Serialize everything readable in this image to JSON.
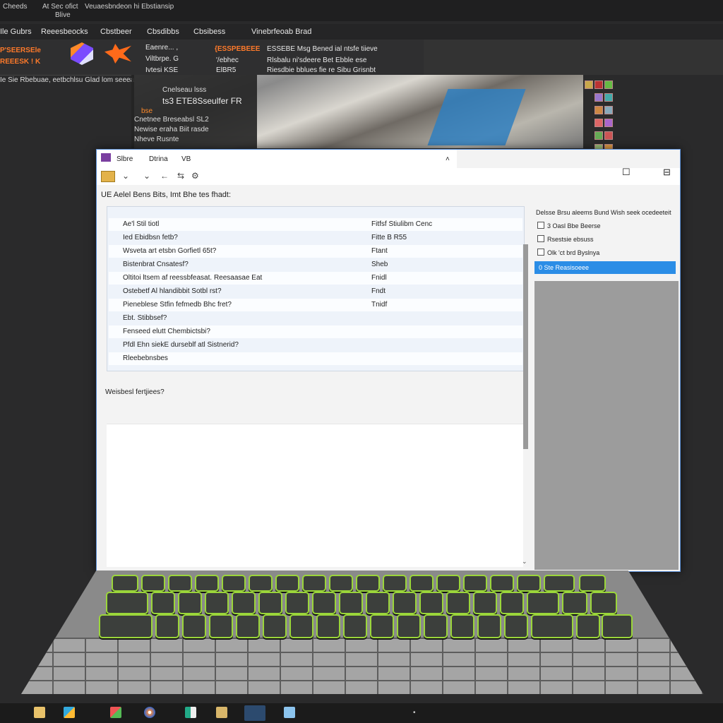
{
  "topmenu": {
    "items": [
      "Cheeds",
      "At Sec ofict",
      "Blive",
      "Veuaesbndeon hi Ebstiansip"
    ]
  },
  "menubar": {
    "items": [
      "Ile Gubrs",
      "Reeesbeocks",
      "Cbstbeer",
      "Cbsdibbs",
      "Cbsibess",
      "Vinebrfeoab Brad"
    ]
  },
  "toolbar": {
    "left_title": "P'SEERSEle",
    "left_sub": "REEESK ! K",
    "items": [
      "Eaenre... ,",
      "Viltbrpe. G",
      "Ivtesi KSE",
      "{ESSPEBEEE",
      "'/ebhec",
      "ElBR5",
      "ESSEBE Msg Bened ial ntsfe tiieve",
      "Rlsbalu ni'sdeere Bet Ebble ese",
      "Riesdbie bblues fie re Sibu Grisnbt"
    ]
  },
  "subtitle": "Ie Sie Rbebuae, eetbchlsu Glad lom seeeat",
  "codepanel": {
    "lines": [
      "Cnelseau lsss",
      "ts3 ETE8Sseulfer FR",
      "bse",
      "Cnetnee Breseabsl SL2",
      "Newise eraha Biit rasde",
      "Nheve Rusnte"
    ]
  },
  "dialog": {
    "tabs": [
      "Slbre",
      "Dtrina",
      "VB"
    ],
    "header": "UE Aelel Bens Bits, Imt Bhe tes fhadt:",
    "rows": [
      {
        "label": "Ae'l Stil tiotl",
        "value": "Fitfsf Stiulibm Cenc"
      },
      {
        "label": "Ied Ebidbsn fetb?",
        "value": "Fitte B R55"
      },
      {
        "label": "Wsveta art etsbn Gorfietl 65t?",
        "value": "Ftant"
      },
      {
        "label": "Bistenbrat Cnsatesf?",
        "value": "Sheb"
      },
      {
        "label": "Oltitoi ltsem af reessbfeasat. Reesaasae Eat",
        "value": "Fnidl"
      },
      {
        "label": "Ostebetf Al hlandibbit Sotbl rst?",
        "value": "Fndt"
      },
      {
        "label": "Pieneblese Stfin fefmedb Bhc fret?",
        "value": "Tnidf"
      },
      {
        "label": "Ebt. Stibbsef?",
        "value": ""
      },
      {
        "label": "Fenseed elutt Chembictsbi?",
        "value": ""
      },
      {
        "label": "Pfdl Ehn siekE durseblf atl Sistnerid?",
        "value": ""
      },
      {
        "label": "Rleebebnsbes",
        "value": ""
      }
    ],
    "note": "Weisbesl fertjiees?",
    "right_panel": {
      "title": "Delsse Brsu aleems Bund Wish seek ocedeeteit",
      "options": [
        "3 Oasl Bbe Beerse",
        "Rsestsie ebsuss",
        "Olk 'ct brd Byslnya"
      ],
      "selected": "0 Ste Reasisoeee"
    }
  },
  "taskbar": {
    "icons": [
      "folder-icon",
      "store-icon",
      "paint-icon",
      "browser-icon",
      "explorer-icon",
      "notes-icon",
      "editor-icon",
      "document-icon"
    ]
  }
}
